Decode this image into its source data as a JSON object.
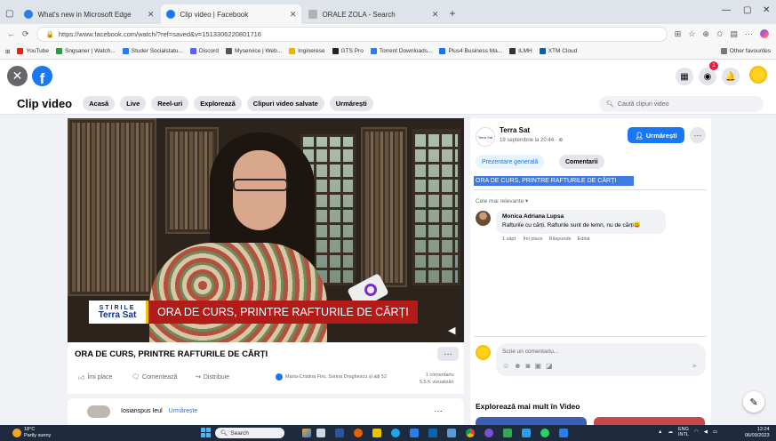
{
  "browser": {
    "tabs": [
      {
        "title": "What's new in Microsoft Edge",
        "favicon_color": "#2b7de9",
        "active": false
      },
      {
        "title": "Clip video | Facebook",
        "favicon_color": "#1877f2",
        "active": true
      },
      {
        "title": "ORALE ZOLA - Search",
        "favicon_color": "#b0b0b0",
        "active": false
      }
    ],
    "new_tab_label": "+",
    "url": "https://www.facebook.com/watch/?ref=saved&v=1513306220801716",
    "favorites": [
      {
        "label": "YouTube",
        "color": "#e62117"
      },
      {
        "label": "Sngsaner | Watch...",
        "color": "#2c9a3e"
      },
      {
        "label": "Studer Socialstatu...",
        "color": "#2b7de9"
      },
      {
        "label": "Discord",
        "color": "#5865f2"
      },
      {
        "label": "Myservice | Web...",
        "color": "#555555"
      },
      {
        "label": "Inginerese",
        "color": "#e6b800"
      },
      {
        "label": "GTS Pro",
        "color": "#222222"
      },
      {
        "label": "Torrent Downloads...",
        "color": "#2b7de9"
      },
      {
        "label": "Plus4 Business Ma...",
        "color": "#1a73e8"
      },
      {
        "label": "ILMH",
        "color": "#333333"
      },
      {
        "label": "XTM Cloud",
        "color": "#0b5fa5"
      },
      {
        "label": "Other favourites",
        "color": "#777777"
      }
    ]
  },
  "fb": {
    "watch_title": "Clip video",
    "watch_tabs": [
      "Acasă",
      "Live",
      "Reel-uri",
      "Explorează",
      "Clipuri video salvate",
      "Urmărești"
    ],
    "search_placeholder": "Caută clipuri video",
    "notification_count": "1"
  },
  "video": {
    "brand_top": "STIRILE",
    "brand_name": "Terra Sat",
    "headline": "ORA DE CURS, PRINTRE RAFTURILE DE CĂRȚI",
    "title": "ORA DE CURS, PRINTRE RAFTURILE DE CĂRȚI",
    "actions": [
      "Îmi place",
      "Comentează",
      "Distribuie"
    ],
    "reactors": "Maria-Cristina Firu, Sorina Draghescu și alți 52",
    "comment_count": "1 comentariu",
    "view_count": "5,5 K vizualizări"
  },
  "next_card": {
    "name": "Iosianspus Ieul",
    "follow": "Urmărește"
  },
  "panel": {
    "page_name": "Terra Sat",
    "page_avatar_text": "Terra Sat",
    "date": "19 septembrie la 20:44 · ⊕",
    "follow_label": "Urmărești",
    "tabs": [
      "Prezentare generală",
      "Comentarii"
    ],
    "selected_text": "ORA DE CURS, PRINTRE RAFTURILE DE CĂRȚI",
    "sort_label": "Cele mai relevante ▾",
    "comment": {
      "author": "Monica Adriana Lupsa",
      "text": "Rafturile cu cărți. Rafturile sunt de lemn, nu de cărți😃",
      "actions": [
        "1 săpt.",
        "Îmi place",
        "Răspunde",
        "Editat"
      ]
    },
    "comment_placeholder": "Scrie un comentariu...",
    "explore_title": "Explorează mai mult în Video"
  },
  "taskbar": {
    "temp": "18°C",
    "weather": "Partly sunny",
    "search_label": "Search",
    "lang1": "ENG",
    "lang2": "INTL",
    "time": "12:24",
    "date": "06/09/2023"
  },
  "colors": {
    "fb_blue": "#1877f2",
    "headline_red": "#b31b18",
    "brand_blue": "#0d2f8a"
  }
}
